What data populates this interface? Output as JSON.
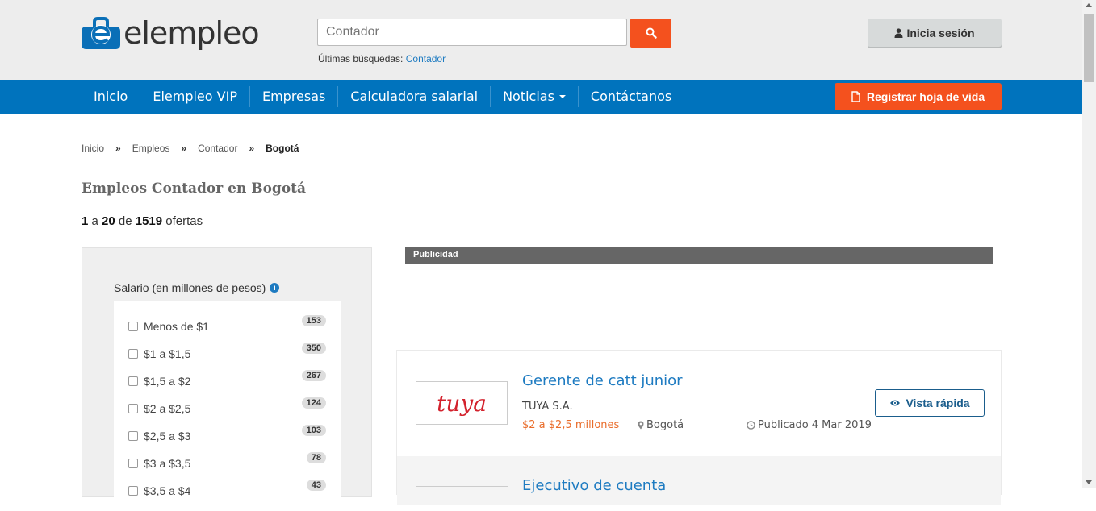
{
  "header": {
    "logo_text": "elempleo",
    "search_placeholder": "Contador",
    "recent_label": "Últimas búsquedas:",
    "recent_link": "Contador",
    "login_label": "Inicia sesión"
  },
  "nav": {
    "items": [
      "Inicio",
      "Elempleo VIP",
      "Empresas",
      "Calculadora salarial",
      "Noticias",
      "Contáctanos"
    ],
    "register_label": "Registrar hoja de vida"
  },
  "breadcrumb": {
    "items": [
      "Inicio",
      "Empleos",
      "Contador"
    ],
    "separator": "»",
    "current": "Bogotá"
  },
  "page": {
    "title": "Empleos Contador en Bogotá",
    "range_start": "1",
    "range_a": "a",
    "range_end": "20",
    "range_de": "de",
    "total": "1519",
    "ofertas": "ofertas"
  },
  "filters": {
    "title": "Salario (en millones de pesos)",
    "options": [
      {
        "label": "Menos de $1",
        "count": "153"
      },
      {
        "label": "$1 a $1,5",
        "count": "350"
      },
      {
        "label": "$1,5 a $2",
        "count": "267"
      },
      {
        "label": "$2 a $2,5",
        "count": "124"
      },
      {
        "label": "$2,5 a $3",
        "count": "103"
      },
      {
        "label": "$3 a $3,5",
        "count": "78"
      },
      {
        "label": "$3,5 a $4",
        "count": "43"
      }
    ]
  },
  "ad": {
    "label": "Publicidad"
  },
  "jobs": [
    {
      "title": "Gerente de catt junior",
      "company": "TUYA S.A.",
      "salary": "$2 a $2,5 millones",
      "city": "Bogotá",
      "date": "Publicado 4 Mar 2019",
      "quick_view": "Vista rápida",
      "logo_text": "tuya"
    },
    {
      "title": "Ejecutivo de cuenta"
    }
  ],
  "colors": {
    "brand_blue": "#0073bd",
    "accent_orange": "#f4511e",
    "link_blue": "#1e7bc1",
    "salary_orange": "#e96c2a"
  }
}
